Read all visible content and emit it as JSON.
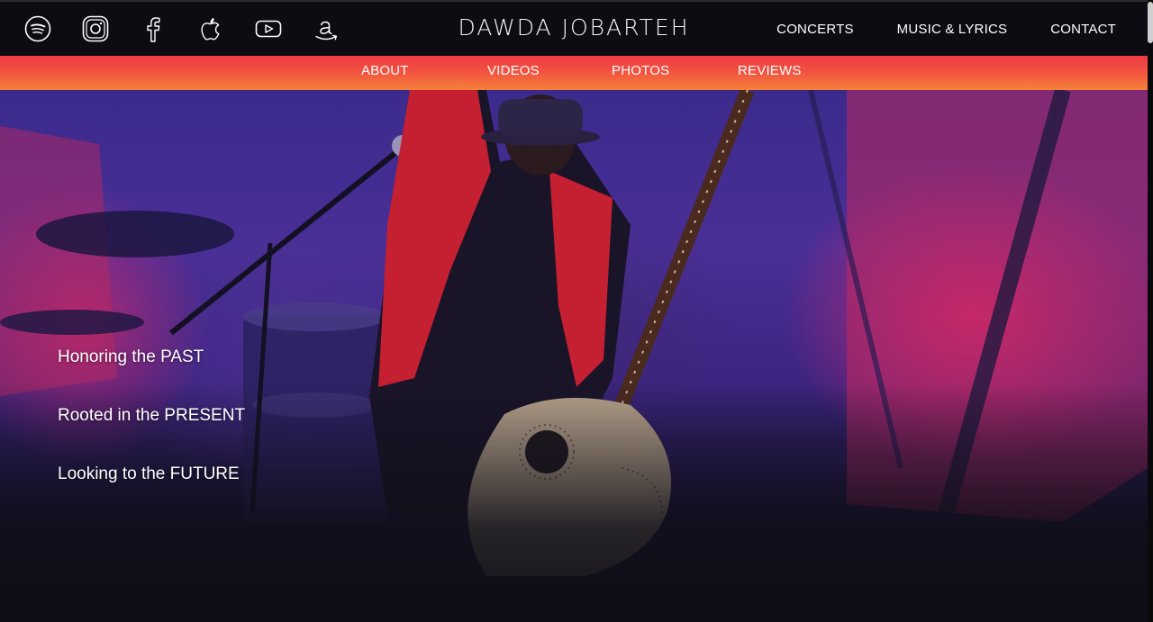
{
  "brand": {
    "name": "DAWDA JOBARTEH"
  },
  "social": {
    "icons": [
      "spotify-icon",
      "instagram-icon",
      "facebook-icon",
      "apple-icon",
      "youtube-icon",
      "amazon-icon"
    ]
  },
  "topnav": {
    "concerts": "CONCERTS",
    "music_lyrics": "MUSIC & LYRICS",
    "contact": "CONTACT"
  },
  "subnav": {
    "about": "ABOUT",
    "videos": "VIDEOS",
    "photos": "PHOTOS",
    "reviews": "REVIEWS"
  },
  "hero": {
    "taglines": [
      "Honoring the PAST",
      "Rooted in the PRESENT",
      "Looking to the FUTURE"
    ]
  },
  "colors": {
    "topbar": "#0d0c12",
    "subbar_top": "#ee3a45",
    "subbar_bottom": "#f6813a",
    "hero_purple": "#3b2a8c",
    "hero_magenta": "#e6286e",
    "page_bg": "#0f0e17"
  }
}
